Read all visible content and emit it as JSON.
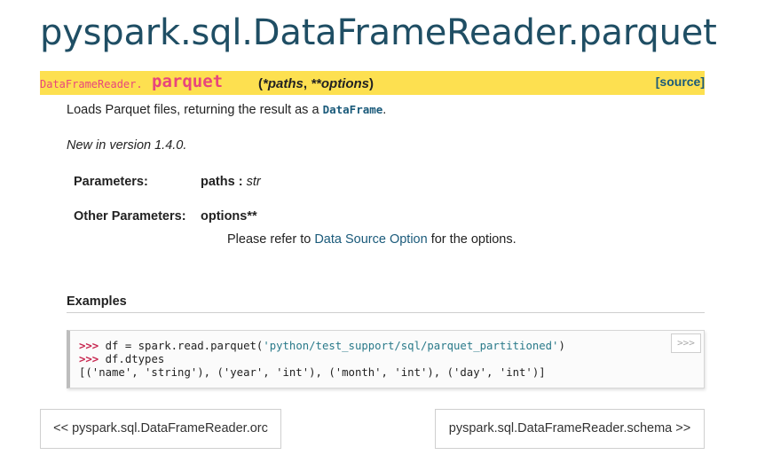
{
  "page": {
    "title": "pyspark.sql.DataFrameReader.parquet"
  },
  "signature": {
    "class_prefix": "DataFrameReader.",
    "method": "parquet",
    "args_open": "(",
    "arg1": "*paths",
    "sep": ", ",
    "arg2": "**options",
    "args_close": ")",
    "source_link": "[source]"
  },
  "description": {
    "text_before": "Loads Parquet files, returning the result as a ",
    "code": "DataFrame",
    "text_after": ".",
    "new_in": "New in version 1.4.0."
  },
  "parameters": {
    "label": "Parameters:",
    "name": "paths",
    "colon": " : ",
    "type": "str"
  },
  "other_parameters": {
    "label": "Other Parameters:",
    "name": "options**",
    "desc_before": "Please refer to ",
    "link": "Data Source Option",
    "desc_after": " for the options."
  },
  "examples": {
    "heading": "Examples",
    "copy_button": ">>>",
    "prompt": ">>>",
    "line1_code": " df = spark.read.parquet(",
    "line1_string": "'python/test_support/sql/parquet_partitioned'",
    "line1_end": ")",
    "line2_code": " df.dtypes",
    "output": "[('name', 'string'), ('year', 'int'), ('month', 'int'), ('day', 'int')]"
  },
  "navigation": {
    "prev": "<< pyspark.sql.DataFrameReader.orc",
    "next": "pyspark.sql.DataFrameReader.schema >>"
  }
}
